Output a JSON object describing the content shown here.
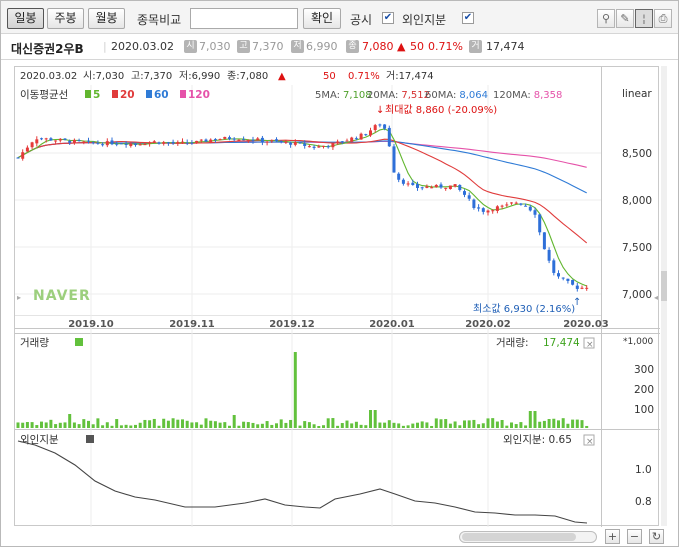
{
  "toolbar": {
    "period_buttons": [
      "일봉",
      "주봉",
      "월봉"
    ],
    "compare_label": "종목비교",
    "compare_value": "",
    "confirm_label": "확인",
    "disclosure_label": "공시",
    "foreign_label": "외인지분"
  },
  "stock": {
    "name": "대신증권2우B",
    "date": "2020.03.02",
    "open_badge": "시",
    "open": "7,030",
    "high_badge": "고",
    "high": "7,370",
    "low_badge": "저",
    "low": "6,990",
    "close_badge": "종",
    "close": "7,080",
    "change_arrow": "▲",
    "change": "50",
    "change_pct": "0.71%",
    "volume_badge": "거",
    "volume": "17,474"
  },
  "price_panel": {
    "info_line": {
      "date": "2020.03.02",
      "open": "시:7,030",
      "high": "고:7,370",
      "low": "저:6,990",
      "close": "종:7,080",
      "arrow": "▲",
      "change": "50",
      "pct": "0.71%",
      "volume": "거:17,474"
    },
    "ma_title": "이동평균선",
    "ma_legend": [
      {
        "label": "5",
        "color": "#62b62f"
      },
      {
        "label": "20",
        "color": "#e03c3c"
      },
      {
        "label": "60",
        "color": "#2f7bd6"
      },
      {
        "label": "120",
        "color": "#e552a9"
      }
    ],
    "ma_values": [
      {
        "label": "5MA:",
        "value": "7,108",
        "color": "#4ea02a"
      },
      {
        "label": "20MA:",
        "value": "7,512",
        "color": "#d63030"
      },
      {
        "label": "60MA:",
        "value": "8,064",
        "color": "#2f7bd6"
      },
      {
        "label": "120MA:",
        "value": "8,358",
        "color": "#e552a9"
      }
    ],
    "scale_label": "linear",
    "max_label": "최대값 8,860 (-20.09%)",
    "min_label": "최소값 6,930 (2.16%)",
    "watermark": "NAVER",
    "y_ticks": [
      "8,500",
      "8,000",
      "7,500",
      "7,000"
    ],
    "x_ticks": [
      "2019.10",
      "2019.11",
      "2019.12",
      "2020.01",
      "2020.02",
      "2020.03"
    ]
  },
  "volume_panel": {
    "title": "거래량",
    "right_label": "거래량:",
    "right_value": "17,474",
    "unit": "*1,000",
    "y_ticks": [
      "300",
      "200",
      "100"
    ],
    "color": "#62c13c"
  },
  "foreign_panel": {
    "title": "외인지분",
    "right_label": "외인지분: 0.65",
    "y_ticks": [
      "1.0",
      "0.8"
    ]
  },
  "colors": {
    "up": "#e53a3a",
    "down": "#2e6fd8",
    "ma5": "#62b62f",
    "ma20": "#e03c3c",
    "ma60": "#2f7bd6",
    "ma120": "#e552a9",
    "foreign_line": "#444444"
  },
  "bottom_controls": [
    "+",
    "−",
    "↻"
  ]
}
